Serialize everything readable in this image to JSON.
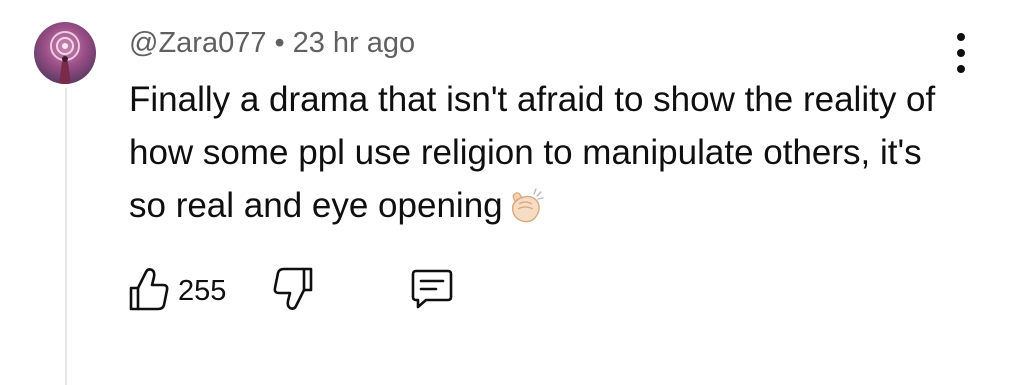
{
  "comment": {
    "author": "@Zara077",
    "separator": "•",
    "timestamp": "23 hr ago",
    "text": "Finally a drama that isn't afraid to show the reality of how some ppl use religion to manipulate others, it's so real and eye opening",
    "emoji": "clapping-hands-icon",
    "likes": "255"
  },
  "icons": {
    "like": "thumbs-up-icon",
    "dislike": "thumbs-down-icon",
    "reply": "comment-bubble-icon",
    "menu": "more-vertical-icon"
  }
}
